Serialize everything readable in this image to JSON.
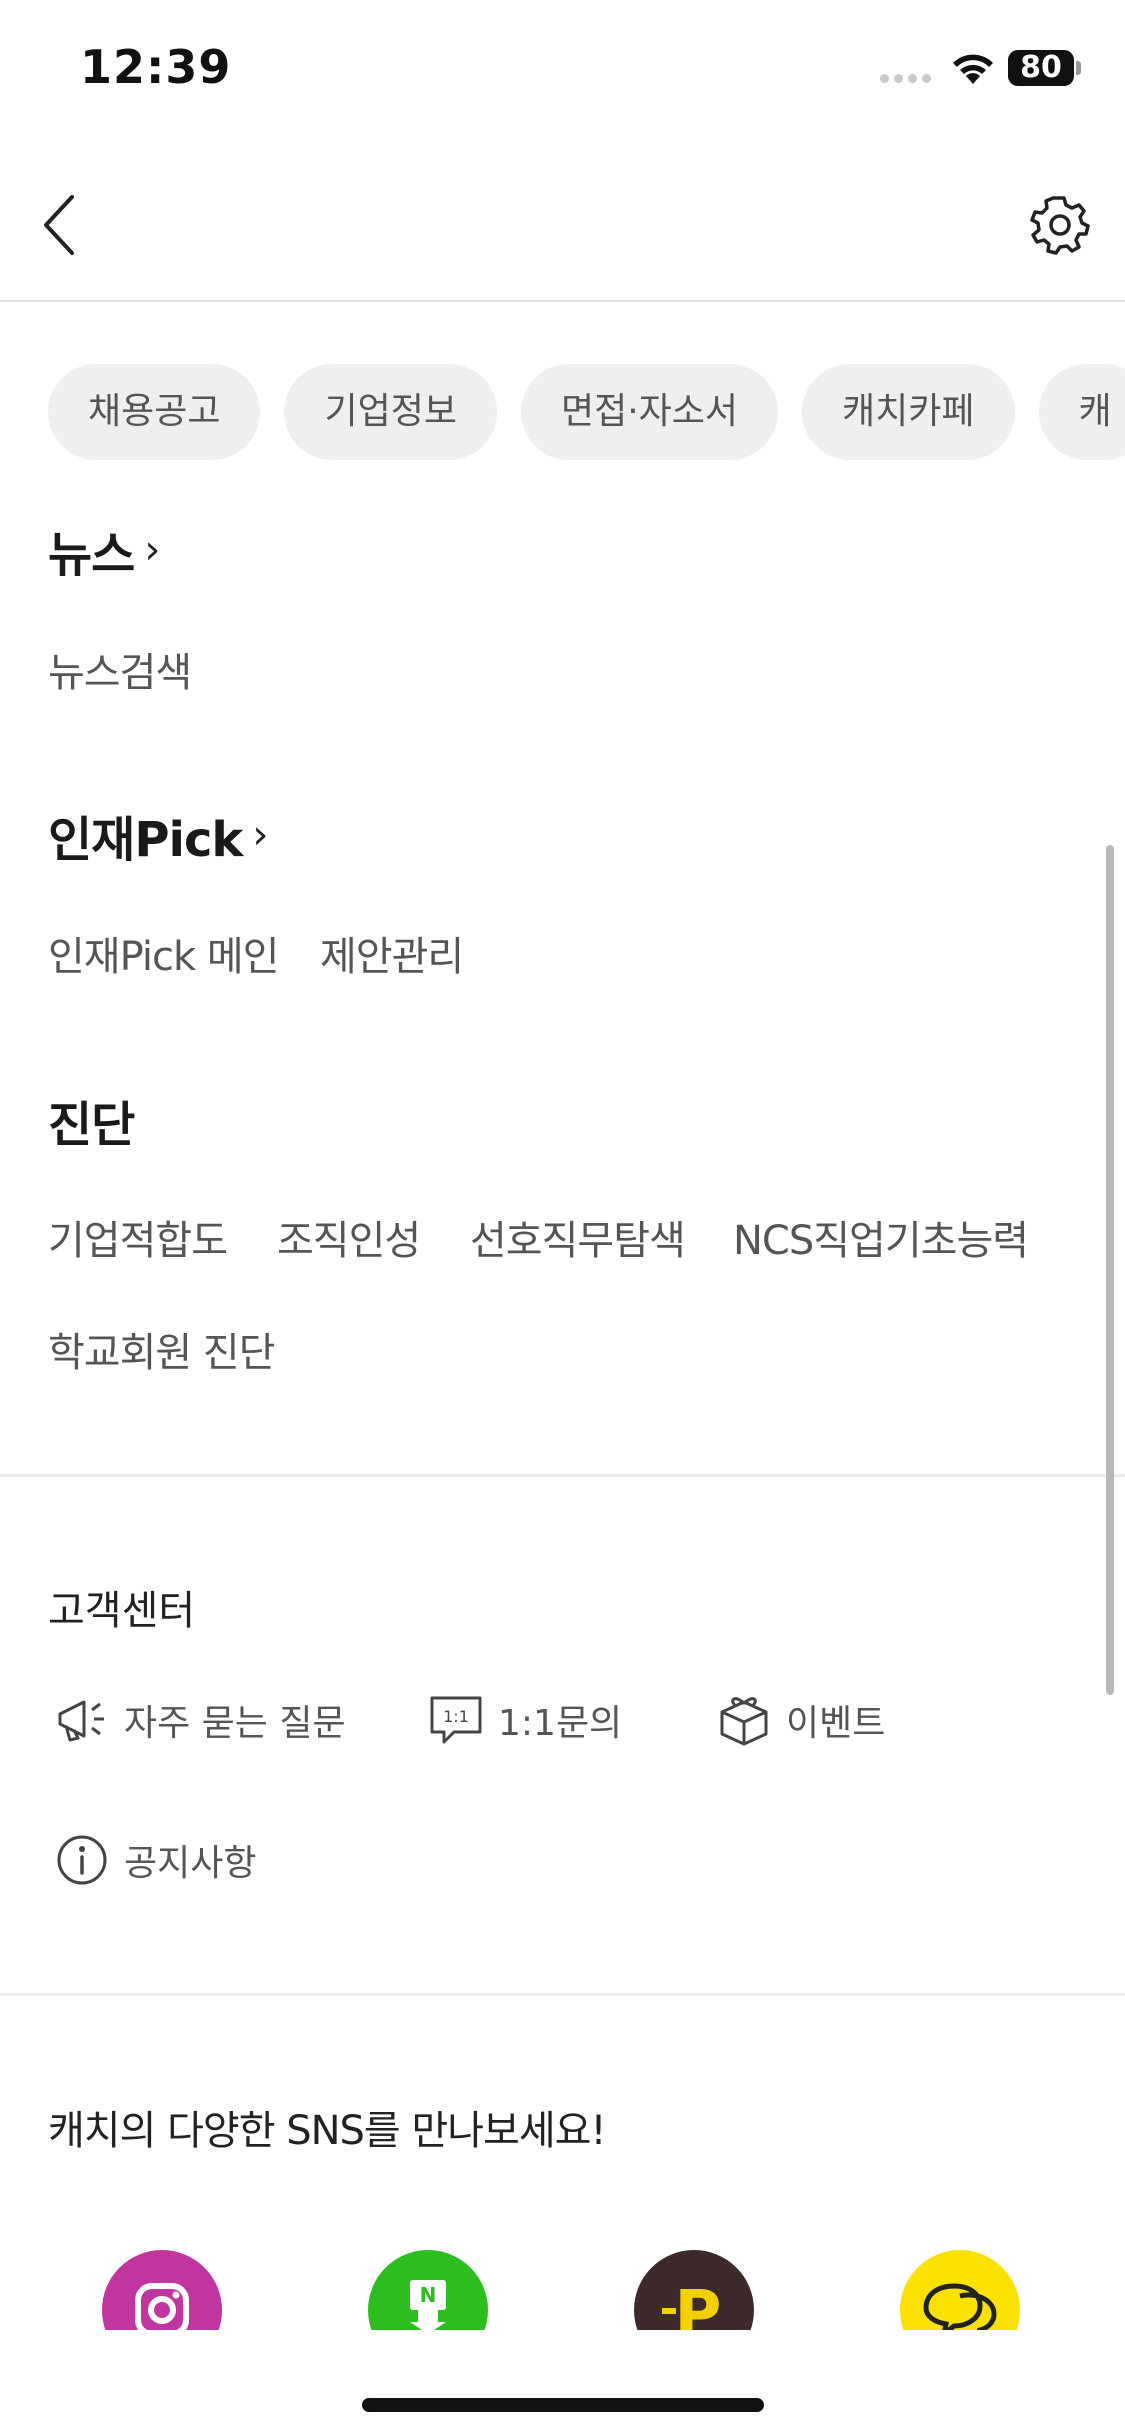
{
  "status": {
    "time": "12:39",
    "battery": "80"
  },
  "chips": [
    "채용공고",
    "기업정보",
    "면접·자소서",
    "캐치카페",
    "캐"
  ],
  "news": {
    "title": "뉴스",
    "links": [
      "뉴스검색"
    ]
  },
  "talent": {
    "title": "인재Pick",
    "links": [
      "인재Pick 메인",
      "제안관리"
    ]
  },
  "diagnosis": {
    "title": "진단",
    "links": [
      "기업적합도",
      "조직인성",
      "선호직무탐색",
      "NCS직업기초능력",
      "학교회원 진단"
    ]
  },
  "customer_center": {
    "title": "고객센터",
    "items": [
      {
        "label": "자주 묻는 질문",
        "icon": "megaphone-icon"
      },
      {
        "label": "1:1문의",
        "icon": "chat-bubble-icon",
        "icon_text": "1:1"
      },
      {
        "label": "이벤트",
        "icon": "gift-box-icon"
      },
      {
        "label": "공지사항",
        "icon": "info-icon"
      }
    ]
  },
  "sns": {
    "title": "캐치의 다양한 SNS를 만나보세요!",
    "items": [
      {
        "name": "instagram",
        "icon": "instagram-icon",
        "color": "#c1359f"
      },
      {
        "name": "naver blog",
        "icon": "naver-blog-icon",
        "color": "#2dbd1f",
        "letter": "N"
      },
      {
        "name": "podcast",
        "icon": "podcast-icon",
        "color": "#3d2a2a",
        "letter": "P"
      },
      {
        "name": "kakao talk",
        "icon": "kakao-talk-icon",
        "color": "#fae100"
      }
    ]
  }
}
